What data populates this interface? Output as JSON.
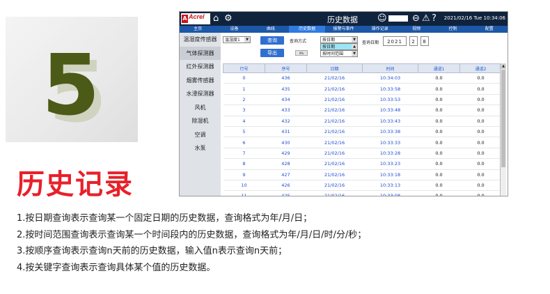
{
  "decor": {
    "big_number": "5"
  },
  "title": "历史记录",
  "hmi": {
    "logo_text": "Acrel",
    "system_title": "历史数据",
    "datetime": "2021/02/16 Tue 10:34:06",
    "nav": [
      "主页",
      "设备",
      "曲线",
      "历史数据",
      "报警与事件",
      "操作记录",
      "视频",
      "控制",
      "配置"
    ],
    "active_nav": 3,
    "left_menu": [
      "温湿度传感器",
      "气体探测器",
      "红外探测器",
      "烟雾传感器",
      "水浸探测器",
      "风机",
      "除湿机",
      "空调",
      "水泵"
    ],
    "query": {
      "device_select": "温湿度1",
      "query_button": "查询",
      "export_button": "导出",
      "method_label": "查询方式",
      "method_options": [
        "按日期",
        "按日期",
        "按时间范围"
      ],
      "selected_method": "按日期",
      "progress": "0%",
      "date_label": "查询日期",
      "year": "2021",
      "month": "2",
      "day": "8"
    },
    "table": {
      "columns": [
        "行号",
        "序号",
        "日期",
        "时间",
        "通道1",
        "通道2"
      ],
      "rows": [
        [
          "0",
          "436",
          "21/02/16",
          "10:34:03",
          "0.0",
          "0.0"
        ],
        [
          "1",
          "435",
          "21/02/16",
          "10:33:58",
          "0.0",
          "0.0"
        ],
        [
          "2",
          "434",
          "21/02/16",
          "10:33:53",
          "0.0",
          "0.0"
        ],
        [
          "3",
          "433",
          "21/02/16",
          "10:33:48",
          "0.0",
          "0.0"
        ],
        [
          "4",
          "432",
          "21/02/16",
          "10:33:43",
          "0.0",
          "0.0"
        ],
        [
          "5",
          "431",
          "21/02/16",
          "10:33:38",
          "0.0",
          "0.0"
        ],
        [
          "6",
          "430",
          "21/02/16",
          "10:33:33",
          "0.0",
          "0.0"
        ],
        [
          "7",
          "429",
          "21/02/16",
          "10:33:28",
          "0.0",
          "0.0"
        ],
        [
          "8",
          "428",
          "21/02/16",
          "10:33:23",
          "0.0",
          "0.0"
        ],
        [
          "9",
          "427",
          "21/02/16",
          "10:33:18",
          "0.0",
          "0.0"
        ],
        [
          "10",
          "426",
          "21/02/16",
          "10:33:13",
          "0.0",
          "0.0"
        ],
        [
          "11",
          "425",
          "21/02/16",
          "10:33:08",
          "0.0",
          "0.0"
        ],
        [
          "12",
          "424",
          "21/02/16",
          "10:33:03",
          "0.0",
          "0.0"
        ],
        [
          "13",
          "423",
          "21/02/16",
          "10:32:58",
          "0.0",
          "0.0"
        ]
      ]
    }
  },
  "notes": [
    "1.按日期查询表示查询某一个固定日期的历史数据，查询格式为年/月/日；",
    "2.按时间范围查询表示查询某一个时间段内的历史数据，查询格式为年/月/日/时/分/秒；",
    "3.按顺序查询表示查询n天前的历史数据，输入值n表示查询n天前；",
    "4.按关键字查询表示查询具体某个值的历史数据。"
  ]
}
